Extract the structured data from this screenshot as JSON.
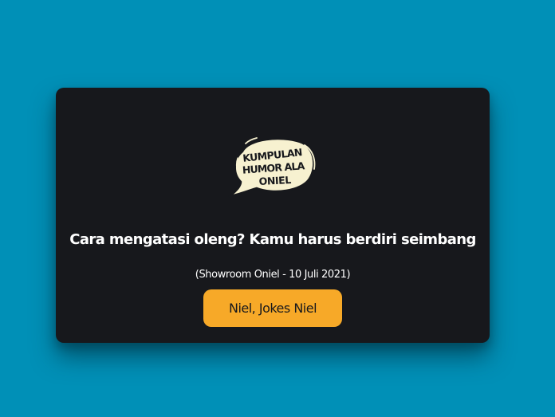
{
  "logo": {
    "icon": "speech-bubble-icon",
    "lines": [
      "KUMPULAN",
      "HUMOR ALA",
      "ONIEL"
    ]
  },
  "joke": {
    "text": "Cara mengatasi oleng? Kamu harus berdiri seimbang",
    "source": "(Showroom Oniel - 10 Juli 2021)"
  },
  "button": {
    "label": "Niel, Jokes Niel"
  },
  "colors": {
    "background": "#0090b7",
    "card": "#17181c",
    "button": "#f7a928",
    "bubble": "#f7f1d0"
  }
}
